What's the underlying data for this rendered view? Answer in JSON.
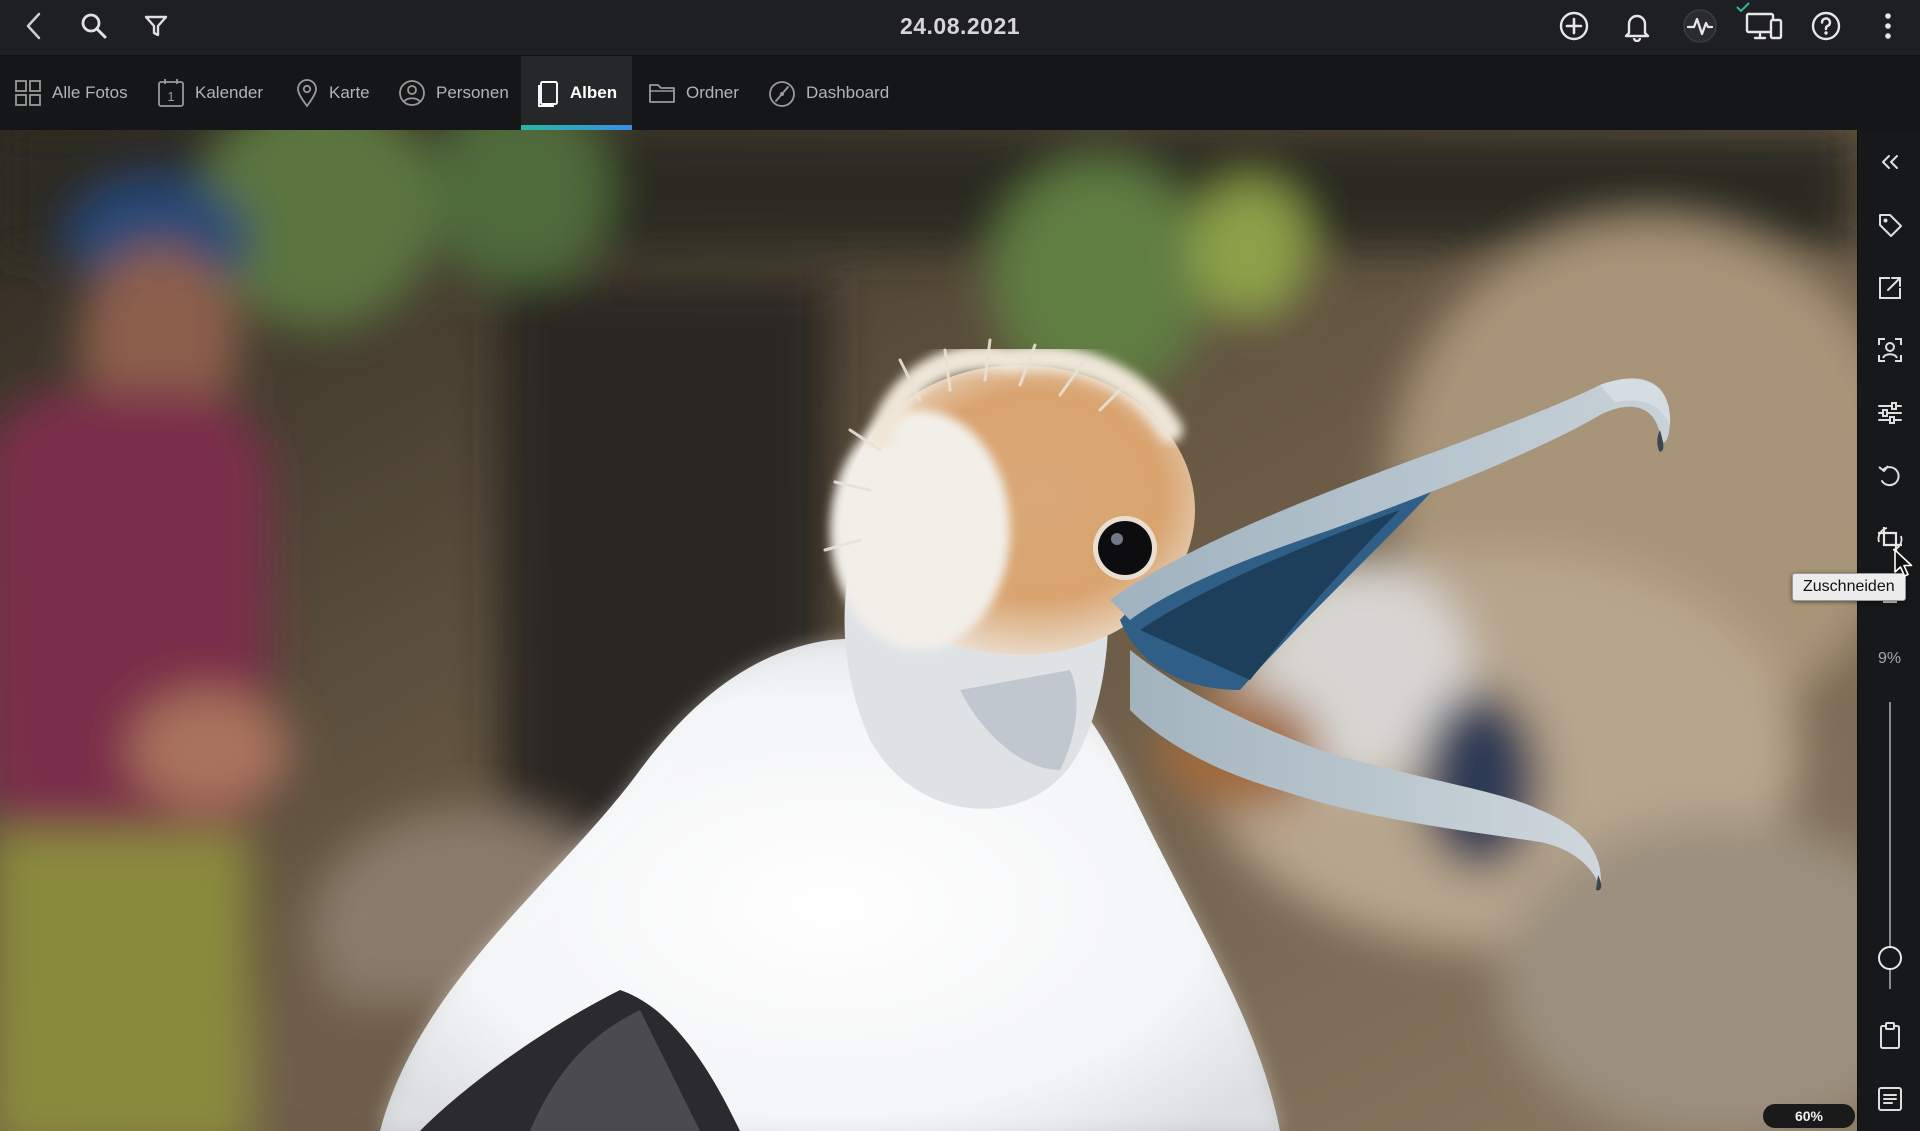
{
  "header": {
    "title": "24.08.2021",
    "icons": [
      "back-icon",
      "search-icon",
      "filter-icon",
      "add-icon",
      "bell-icon",
      "activity-icon",
      "devices-icon",
      "help-icon",
      "more-icon"
    ]
  },
  "nav": {
    "tabs": [
      {
        "label": "Alle Fotos",
        "icon": "grid-icon"
      },
      {
        "label": "Kalender",
        "icon": "calendar-icon",
        "calendar_day": "1"
      },
      {
        "label": "Karte",
        "icon": "map-pin-icon"
      },
      {
        "label": "Personen",
        "icon": "person-icon"
      },
      {
        "label": "Alben",
        "icon": "album-icon",
        "active": true
      },
      {
        "label": "Ordner",
        "icon": "folder-icon"
      },
      {
        "label": "Dashboard",
        "icon": "dashboard-icon"
      }
    ],
    "accent_gradient": [
      "#2bb7a0",
      "#3a8ee6"
    ]
  },
  "sidebar": {
    "tools": [
      "collapse-icon",
      "tag-icon",
      "open-external-icon",
      "face-scan-icon",
      "adjust-icon",
      "rotate-icon",
      "crop-icon",
      "clipboard-icon",
      "details-icon"
    ],
    "percent_label": "9%",
    "zoom_slider_value": 0.1
  },
  "tooltip": {
    "text": "Zuschneiden"
  },
  "zoom": {
    "label": "60%"
  }
}
